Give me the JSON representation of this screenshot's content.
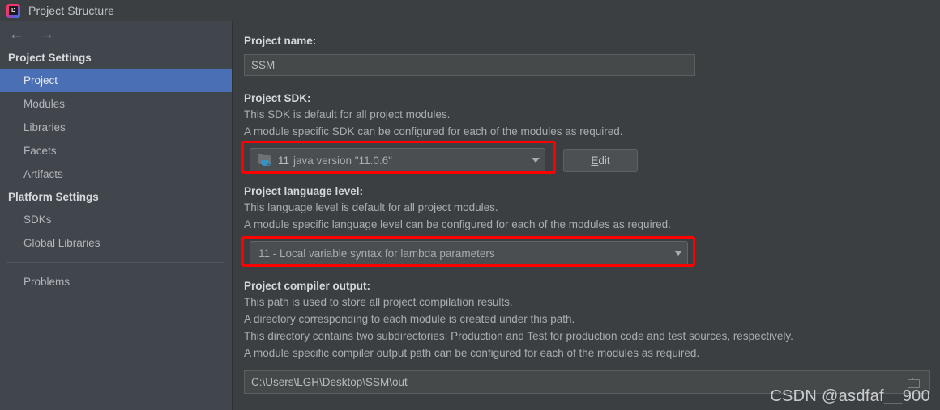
{
  "window": {
    "title": "Project Structure",
    "app_icon": "intellij-idea-logo-icon"
  },
  "toolbar": {
    "back_icon": "arrow-left-icon",
    "forward_icon": "arrow-right-icon"
  },
  "sidebar": {
    "groups": [
      {
        "title": "Project Settings",
        "items": [
          {
            "label": "Project",
            "selected": true
          },
          {
            "label": "Modules",
            "selected": false
          },
          {
            "label": "Libraries",
            "selected": false
          },
          {
            "label": "Facets",
            "selected": false
          },
          {
            "label": "Artifacts",
            "selected": false
          }
        ]
      },
      {
        "title": "Platform Settings",
        "items": [
          {
            "label": "SDKs",
            "selected": false
          },
          {
            "label": "Global Libraries",
            "selected": false
          }
        ]
      }
    ],
    "extra_items": [
      {
        "label": "Problems",
        "selected": false
      }
    ]
  },
  "main": {
    "project_name": {
      "label": "Project name:",
      "value": "SSM"
    },
    "project_sdk": {
      "label": "Project SDK:",
      "desc1": "This SDK is default for all project modules.",
      "desc2": "A module specific SDK can be configured for each of the modules as required.",
      "selected_version": "11",
      "selected_detail": "java version \"11.0.6\"",
      "icon": "java-sdk-folder-icon",
      "caret_icon": "chevron-down-icon",
      "edit_button": "Edit",
      "edit_button_mnemonic": "E",
      "edit_button_rest": "dit",
      "highlighted": true
    },
    "language_level": {
      "label": "Project language level:",
      "desc1": "This language level is default for all project modules.",
      "desc2": "A module specific language level can be configured for each of the modules as required.",
      "selected": "11 - Local variable syntax for lambda parameters",
      "caret_icon": "chevron-down-icon",
      "highlighted": true
    },
    "compiler_output": {
      "label": "Project compiler output:",
      "desc1": "This path is used to store all project compilation results.",
      "desc2": "A directory corresponding to each module is created under this path.",
      "desc3": "This directory contains two subdirectories: Production and Test for production code and test sources, respectively.",
      "desc4": "A module specific compiler output path can be configured for each of the modules as required.",
      "path_value": "C:\\Users\\LGH\\Desktop\\SSM\\out",
      "browse_icon": "folder-browse-icon"
    }
  },
  "watermark": {
    "text": "CSDN @asdfaf__900"
  },
  "colors": {
    "accent_selection": "#4a6fb5",
    "annotation_red": "#fe0000",
    "panel_bg": "#3c3f41",
    "sidebar_bg": "#41454c",
    "java_blue": "#3592c4"
  }
}
